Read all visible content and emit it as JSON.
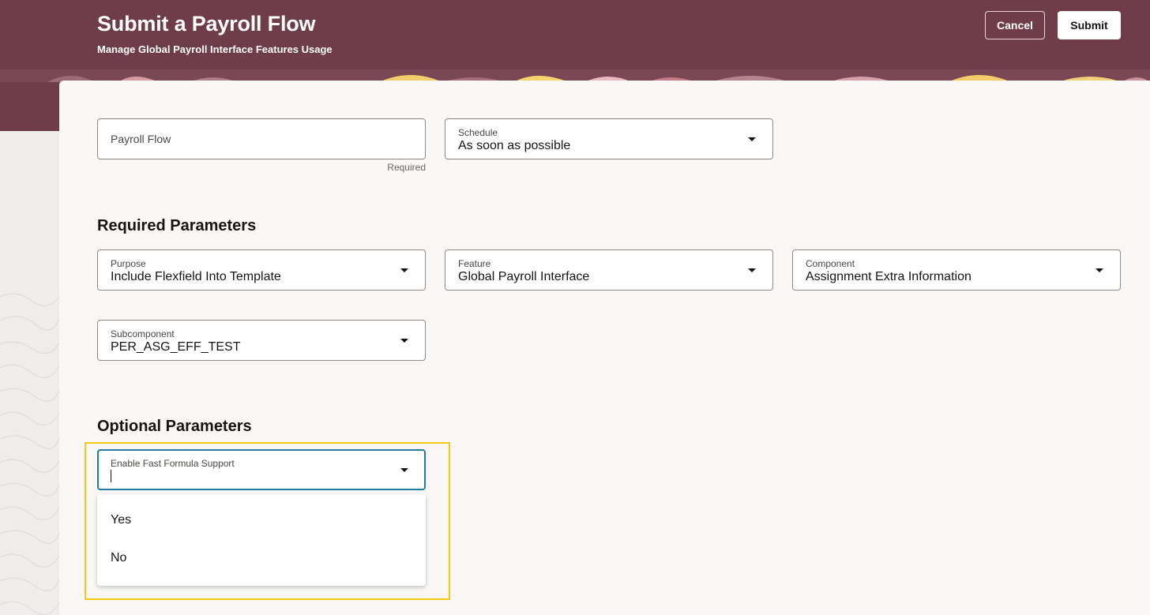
{
  "header": {
    "title": "Submit a Payroll Flow",
    "subtitle": "Manage Global Payroll Interface Features Usage",
    "cancel_label": "Cancel",
    "submit_label": "Submit"
  },
  "flow_fields": {
    "payroll_flow": {
      "placeholder": "Payroll Flow",
      "help_text": "Required"
    },
    "schedule": {
      "label": "Schedule",
      "value": "As soon as possible"
    }
  },
  "required_parameters": {
    "heading": "Required Parameters",
    "purpose": {
      "label": "Purpose",
      "value": "Include Flexfield Into Template"
    },
    "feature": {
      "label": "Feature",
      "value": "Global Payroll Interface"
    },
    "component": {
      "label": "Component",
      "value": "Assignment Extra Information"
    },
    "subcomponent": {
      "label": "Subcomponent",
      "value": "PER_ASG_EFF_TEST"
    }
  },
  "optional_parameters": {
    "heading": "Optional Parameters",
    "fast_formula": {
      "label": "Enable Fast Formula Support",
      "value": "",
      "options": [
        "Yes",
        "No"
      ]
    }
  },
  "colors": {
    "banner": "#6e3d49",
    "panel": "#f9f8f6",
    "focus_border": "#227e9e",
    "highlight": "#f7c90f"
  },
  "icons": {
    "dropdown": "caret-down-icon"
  }
}
